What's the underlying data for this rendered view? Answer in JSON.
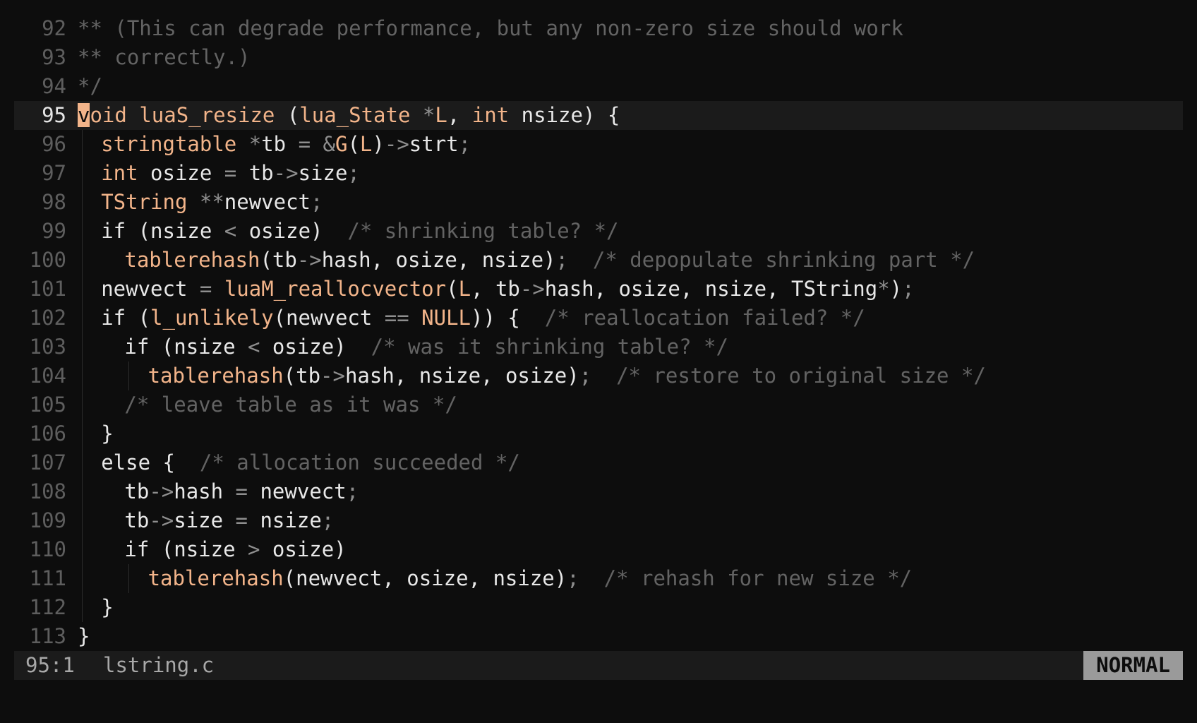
{
  "editor": {
    "cursor_line": "95",
    "lines": [
      {
        "n": "92",
        "indent": 0,
        "tokens": [
          [
            "cm",
            "** (This can degrade performance, but any non-zero size should work"
          ]
        ]
      },
      {
        "n": "93",
        "indent": 0,
        "tokens": [
          [
            "cm",
            "** correctly.)"
          ]
        ]
      },
      {
        "n": "94",
        "indent": 0,
        "tokens": [
          [
            "cm",
            "*/"
          ]
        ]
      },
      {
        "n": "95",
        "indent": 0,
        "tokens": [
          [
            "cursor",
            "v"
          ],
          [
            "ty",
            "oid "
          ],
          [
            "fn",
            "luaS_resize"
          ],
          [
            "pl",
            " ("
          ],
          [
            "ty",
            "lua_State"
          ],
          [
            "pl",
            " "
          ],
          [
            "op",
            "*"
          ],
          [
            "ty",
            "L"
          ],
          [
            "pl",
            ", "
          ],
          [
            "ty",
            "int"
          ],
          [
            "pl",
            " nsize) {"
          ]
        ]
      },
      {
        "n": "96",
        "indent": 1,
        "tokens": [
          [
            "ty",
            "stringtable"
          ],
          [
            "pl",
            " "
          ],
          [
            "op",
            "*"
          ],
          [
            "pl",
            "tb "
          ],
          [
            "op",
            "="
          ],
          [
            "pl",
            " "
          ],
          [
            "op",
            "&"
          ],
          [
            "ty",
            "G"
          ],
          [
            "pl",
            "("
          ],
          [
            "ty",
            "L"
          ],
          [
            "pl",
            ")"
          ],
          [
            "op",
            "->"
          ],
          [
            "pl",
            "strt"
          ],
          [
            "op",
            ";"
          ]
        ]
      },
      {
        "n": "97",
        "indent": 1,
        "tokens": [
          [
            "ty",
            "int"
          ],
          [
            "pl",
            " osize "
          ],
          [
            "op",
            "="
          ],
          [
            "pl",
            " tb"
          ],
          [
            "op",
            "->"
          ],
          [
            "pl",
            "size"
          ],
          [
            "op",
            ";"
          ]
        ]
      },
      {
        "n": "98",
        "indent": 1,
        "tokens": [
          [
            "ty",
            "TString"
          ],
          [
            "pl",
            " "
          ],
          [
            "op",
            "**"
          ],
          [
            "pl",
            "newvect"
          ],
          [
            "op",
            ";"
          ]
        ]
      },
      {
        "n": "99",
        "indent": 1,
        "tokens": [
          [
            "kw",
            "if"
          ],
          [
            "pl",
            " (nsize "
          ],
          [
            "op",
            "<"
          ],
          [
            "pl",
            " osize)  "
          ],
          [
            "cm",
            "/* shrinking table? */"
          ]
        ]
      },
      {
        "n": "100",
        "indent": 2,
        "tokens": [
          [
            "fn",
            "tablerehash"
          ],
          [
            "pl",
            "(tb"
          ],
          [
            "op",
            "->"
          ],
          [
            "pl",
            "hash, osize, nsize)"
          ],
          [
            "op",
            ";"
          ],
          [
            "pl",
            "  "
          ],
          [
            "cm",
            "/* depopulate shrinking part */"
          ]
        ]
      },
      {
        "n": "101",
        "indent": 1,
        "tokens": [
          [
            "pl",
            "newvect "
          ],
          [
            "op",
            "="
          ],
          [
            "pl",
            " "
          ],
          [
            "fn",
            "luaM_reallocvector"
          ],
          [
            "pl",
            "("
          ],
          [
            "ty",
            "L"
          ],
          [
            "pl",
            ", tb"
          ],
          [
            "op",
            "->"
          ],
          [
            "pl",
            "hash, osize, nsize, TString"
          ],
          [
            "op",
            "*"
          ],
          [
            "pl",
            ")"
          ],
          [
            "op",
            ";"
          ]
        ]
      },
      {
        "n": "102",
        "indent": 1,
        "tokens": [
          [
            "kw",
            "if"
          ],
          [
            "pl",
            " ("
          ],
          [
            "fn",
            "l_unlikely"
          ],
          [
            "pl",
            "(newvect "
          ],
          [
            "op",
            "=="
          ],
          [
            "pl",
            " "
          ],
          [
            "ty",
            "NULL"
          ],
          [
            "pl",
            ")) {  "
          ],
          [
            "cm",
            "/* reallocation failed? */"
          ]
        ]
      },
      {
        "n": "103",
        "indent": 2,
        "tokens": [
          [
            "kw",
            "if"
          ],
          [
            "pl",
            " (nsize "
          ],
          [
            "op",
            "<"
          ],
          [
            "pl",
            " osize)  "
          ],
          [
            "cm",
            "/* was it shrinking table? */"
          ]
        ]
      },
      {
        "n": "104",
        "indent": 3,
        "tokens": [
          [
            "fn",
            "tablerehash"
          ],
          [
            "pl",
            "(tb"
          ],
          [
            "op",
            "->"
          ],
          [
            "pl",
            "hash, nsize, osize)"
          ],
          [
            "op",
            ";"
          ],
          [
            "pl",
            "  "
          ],
          [
            "cm",
            "/* restore to original size */"
          ]
        ]
      },
      {
        "n": "105",
        "indent": 2,
        "tokens": [
          [
            "cm",
            "/* leave table as it was */"
          ]
        ]
      },
      {
        "n": "106",
        "indent": 1,
        "tokens": [
          [
            "pl",
            "}"
          ]
        ]
      },
      {
        "n": "107",
        "indent": 1,
        "tokens": [
          [
            "kw",
            "else"
          ],
          [
            "pl",
            " {  "
          ],
          [
            "cm",
            "/* allocation succeeded */"
          ]
        ]
      },
      {
        "n": "108",
        "indent": 2,
        "tokens": [
          [
            "pl",
            "tb"
          ],
          [
            "op",
            "->"
          ],
          [
            "pl",
            "hash "
          ],
          [
            "op",
            "="
          ],
          [
            "pl",
            " newvect"
          ],
          [
            "op",
            ";"
          ]
        ]
      },
      {
        "n": "109",
        "indent": 2,
        "tokens": [
          [
            "pl",
            "tb"
          ],
          [
            "op",
            "->"
          ],
          [
            "pl",
            "size "
          ],
          [
            "op",
            "="
          ],
          [
            "pl",
            " nsize"
          ],
          [
            "op",
            ";"
          ]
        ]
      },
      {
        "n": "110",
        "indent": 2,
        "tokens": [
          [
            "kw",
            "if"
          ],
          [
            "pl",
            " (nsize "
          ],
          [
            "op",
            ">"
          ],
          [
            "pl",
            " osize)"
          ]
        ]
      },
      {
        "n": "111",
        "indent": 3,
        "tokens": [
          [
            "fn",
            "tablerehash"
          ],
          [
            "pl",
            "(newvect, osize, nsize)"
          ],
          [
            "op",
            ";"
          ],
          [
            "pl",
            "  "
          ],
          [
            "cm",
            "/* rehash for new size */"
          ]
        ]
      },
      {
        "n": "112",
        "indent": 1,
        "tokens": [
          [
            "pl",
            "}"
          ]
        ]
      },
      {
        "n": "113",
        "indent": 0,
        "tokens": [
          [
            "pl",
            "}"
          ]
        ]
      }
    ]
  },
  "status": {
    "position": "95:1",
    "filename": "lstring.c",
    "mode": "NORMAL"
  },
  "colors": {
    "background": "#0d0d0d",
    "current_line": "#1b1b1b",
    "accent": "#f2b48a",
    "comment": "#636363",
    "mode_badge": "#9a9a9a"
  }
}
